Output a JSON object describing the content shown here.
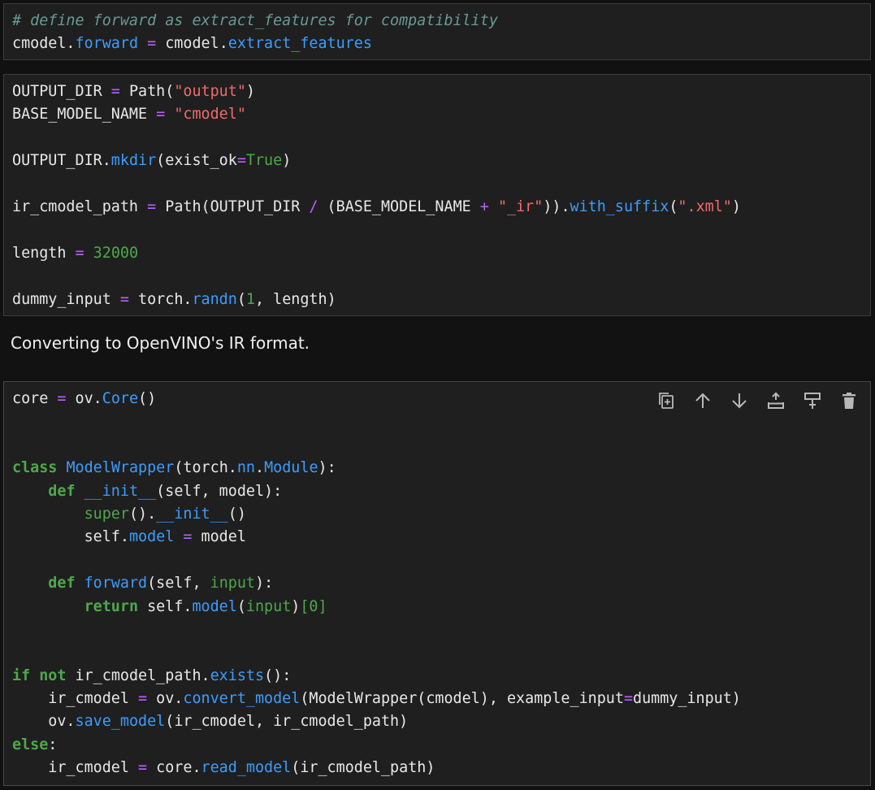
{
  "cells": [
    {
      "lines": [
        [
          [
            "cm",
            "# define forward as extract_features for compatibility"
          ]
        ],
        [
          [
            "",
            "cmodel."
          ],
          [
            "at",
            "forward"
          ],
          [
            "",
            " "
          ],
          [
            "op",
            "="
          ],
          [
            "",
            " cmodel."
          ],
          [
            "at",
            "extract_features"
          ]
        ]
      ]
    },
    {
      "lines": [
        [
          [
            "",
            "OUTPUT_DIR "
          ],
          [
            "op",
            "="
          ],
          [
            "",
            " Path("
          ],
          [
            "st",
            "\"output\""
          ],
          [
            "",
            ")"
          ]
        ],
        [
          [
            "",
            "BASE_MODEL_NAME "
          ],
          [
            "op",
            "="
          ],
          [
            "",
            " "
          ],
          [
            "st",
            "\"cmodel\""
          ]
        ],
        [],
        [
          [
            "",
            "OUTPUT_DIR."
          ],
          [
            "fn",
            "mkdir"
          ],
          [
            "",
            "(exist_ok"
          ],
          [
            "op",
            "="
          ],
          [
            "kw-plain",
            "True"
          ],
          [
            "",
            ")"
          ]
        ],
        [],
        [
          [
            "",
            "ir_cmodel_path "
          ],
          [
            "op",
            "="
          ],
          [
            "",
            " Path(OUTPUT_DIR "
          ],
          [
            "op",
            "/"
          ],
          [
            "",
            " (BASE_MODEL_NAME "
          ],
          [
            "op",
            "+"
          ],
          [
            "",
            " "
          ],
          [
            "st",
            "\"_ir\""
          ],
          [
            "",
            "))."
          ],
          [
            "fn",
            "with_suffix"
          ],
          [
            "",
            "("
          ],
          [
            "st",
            "\".xml\""
          ],
          [
            "",
            ")"
          ]
        ],
        [],
        [
          [
            "",
            "length "
          ],
          [
            "op",
            "="
          ],
          [
            "",
            " "
          ],
          [
            "nm",
            "32000"
          ]
        ],
        [],
        [
          [
            "",
            "dummy_input "
          ],
          [
            "op",
            "="
          ],
          [
            "",
            " torch."
          ],
          [
            "fn",
            "randn"
          ],
          [
            "",
            "("
          ],
          [
            "nm",
            "1"
          ],
          [
            "",
            ", length)"
          ]
        ]
      ]
    },
    {
      "lines": [
        [
          [
            "",
            "core "
          ],
          [
            "op",
            "="
          ],
          [
            "",
            " ov."
          ],
          [
            "fn",
            "Core"
          ],
          [
            "",
            "()"
          ]
        ],
        [],
        [],
        [
          [
            "kw",
            "class"
          ],
          [
            "",
            " "
          ],
          [
            "fn",
            "ModelWrapper"
          ],
          [
            "",
            "(torch."
          ],
          [
            "at",
            "nn"
          ],
          [
            "",
            "."
          ],
          [
            "at",
            "Module"
          ],
          [
            "",
            "):"
          ]
        ],
        [
          [
            "",
            "    "
          ],
          [
            "kw",
            "def"
          ],
          [
            "",
            " "
          ],
          [
            "fn",
            "__init__"
          ],
          [
            "",
            "(self, model):"
          ]
        ],
        [
          [
            "",
            "        "
          ],
          [
            "bi",
            "super"
          ],
          [
            "",
            "()."
          ],
          [
            "fn",
            "__init__"
          ],
          [
            "",
            "()"
          ]
        ],
        [
          [
            "",
            "        self."
          ],
          [
            "at",
            "model"
          ],
          [
            "",
            " "
          ],
          [
            "op",
            "="
          ],
          [
            "",
            " model"
          ]
        ],
        [],
        [
          [
            "",
            "    "
          ],
          [
            "kw",
            "def"
          ],
          [
            "",
            " "
          ],
          [
            "fn",
            "forward"
          ],
          [
            "",
            "(self, "
          ],
          [
            "bi",
            "input"
          ],
          [
            "",
            "):"
          ]
        ],
        [
          [
            "",
            "        "
          ],
          [
            "kw",
            "return"
          ],
          [
            "",
            " self."
          ],
          [
            "fn",
            "model"
          ],
          [
            "",
            "("
          ],
          [
            "bi",
            "input"
          ],
          [
            "",
            ")"
          ],
          [
            "sp",
            "[0]"
          ]
        ],
        [],
        [],
        [
          [
            "kw",
            "if"
          ],
          [
            "",
            " "
          ],
          [
            "kw",
            "not"
          ],
          [
            "",
            " ir_cmodel_path."
          ],
          [
            "fn",
            "exists"
          ],
          [
            "",
            "():"
          ]
        ],
        [
          [
            "",
            "    ir_cmodel "
          ],
          [
            "op",
            "="
          ],
          [
            "",
            " ov."
          ],
          [
            "fn",
            "convert_model"
          ],
          [
            "",
            "(ModelWrapper(cmodel), example_input"
          ],
          [
            "op",
            "="
          ],
          [
            "",
            "dummy_input)"
          ]
        ],
        [
          [
            "",
            "    ov."
          ],
          [
            "fn",
            "save_model"
          ],
          [
            "",
            "(ir_cmodel, ir_cmodel_path)"
          ]
        ],
        [
          [
            "kw",
            "else"
          ],
          [
            "",
            ":"
          ]
        ],
        [
          [
            "",
            "    ir_cmodel "
          ],
          [
            "op",
            "="
          ],
          [
            "",
            " core."
          ],
          [
            "fn",
            "read_model"
          ],
          [
            "",
            "(ir_cmodel_path)"
          ]
        ]
      ]
    }
  ],
  "markdown": {
    "text": "Converting to OpenVINO's IR format."
  },
  "toolbar": {
    "buttons": [
      {
        "name": "copy-cell",
        "icon": "copy-icon"
      },
      {
        "name": "move-up",
        "icon": "arrow-up-icon"
      },
      {
        "name": "move-down",
        "icon": "arrow-down-icon"
      },
      {
        "name": "insert-above",
        "icon": "insert-above-icon"
      },
      {
        "name": "insert-below",
        "icon": "insert-below-icon"
      },
      {
        "name": "delete-cell",
        "icon": "trash-icon"
      }
    ]
  }
}
